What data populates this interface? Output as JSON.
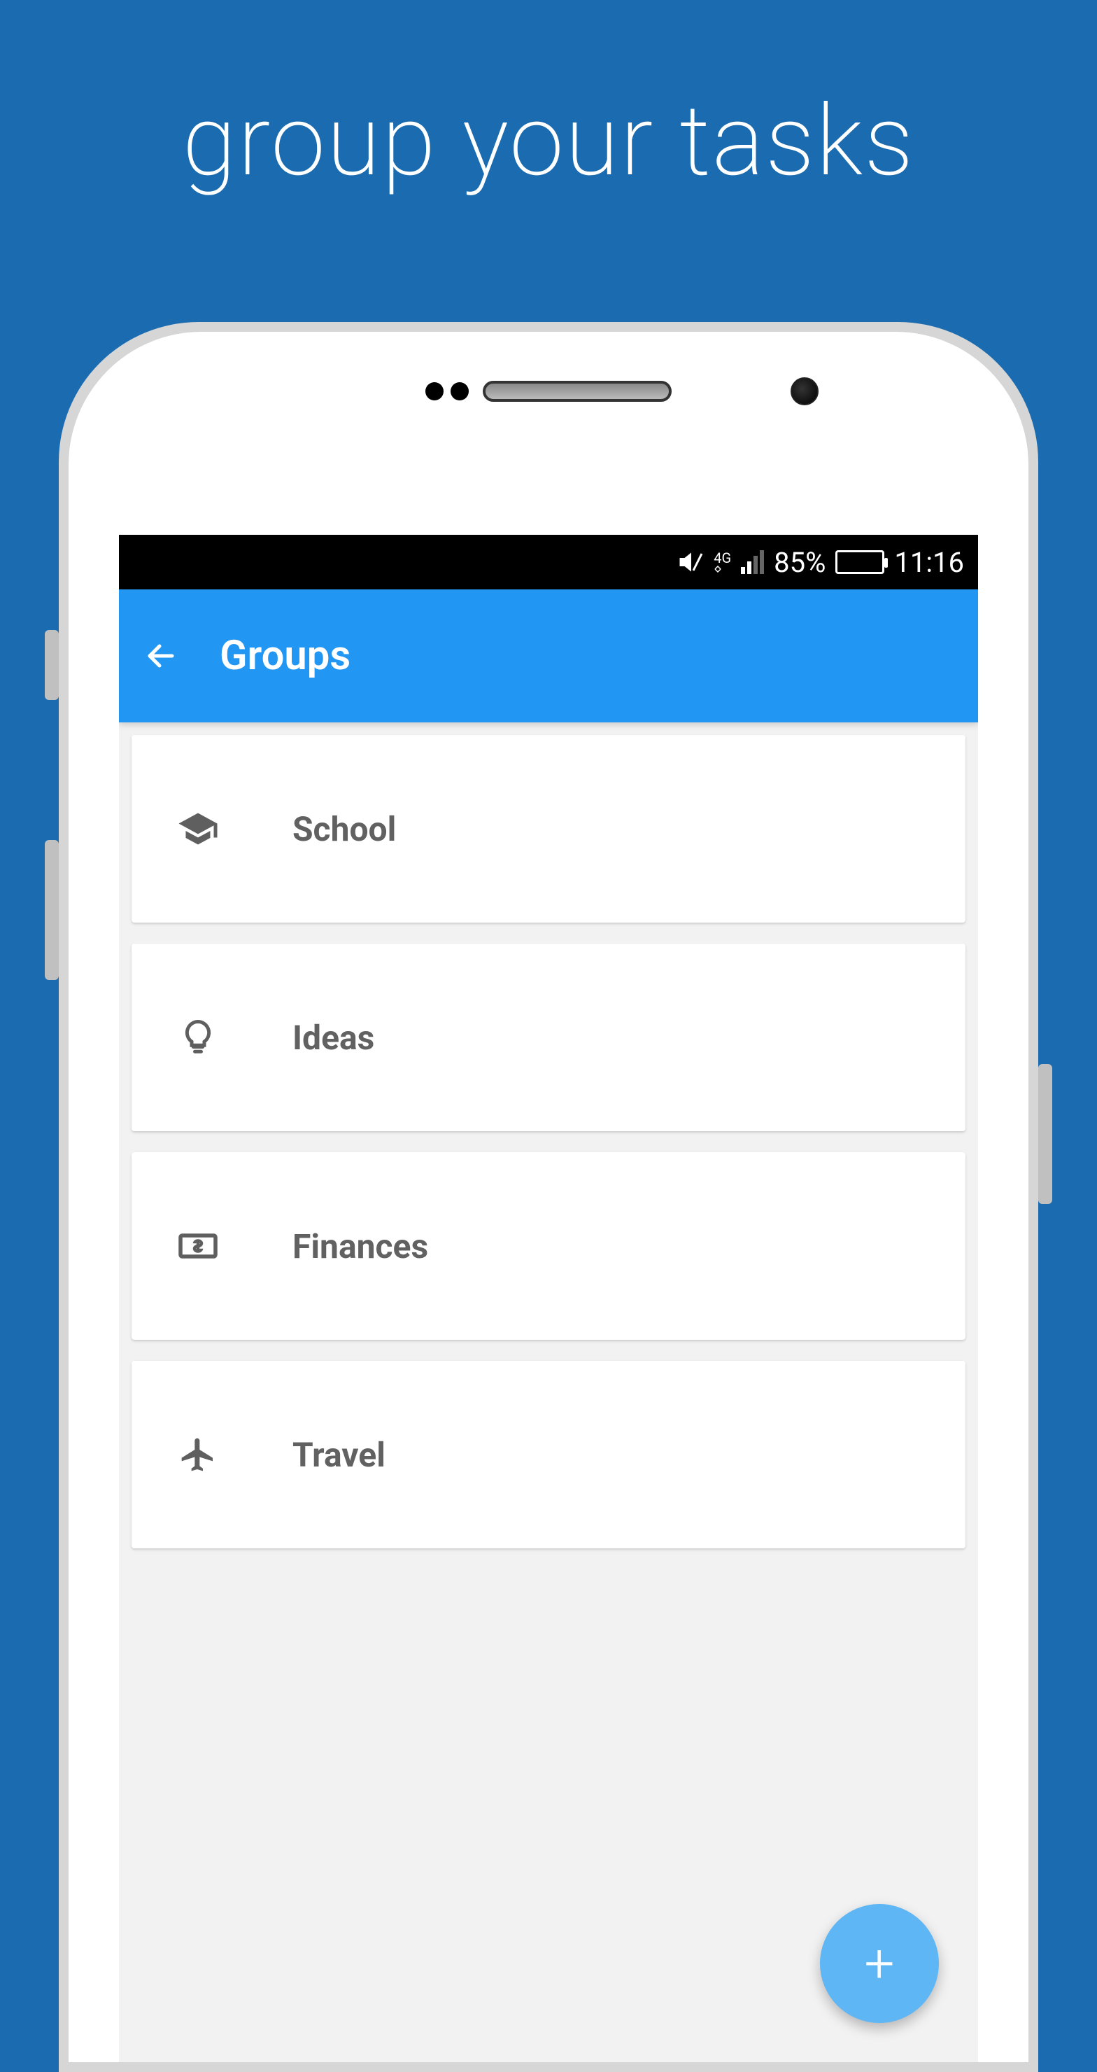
{
  "promo": {
    "title": "group your tasks"
  },
  "statusbar": {
    "battery_pct": "85%",
    "time": "11:16",
    "network": "4G"
  },
  "appbar": {
    "title": "Groups"
  },
  "groups": [
    {
      "icon": "graduation-cap-icon",
      "label": "School"
    },
    {
      "icon": "lightbulb-icon",
      "label": "Ideas"
    },
    {
      "icon": "money-icon",
      "label": "Finances"
    },
    {
      "icon": "airplane-icon",
      "label": "Travel"
    }
  ],
  "fab": {
    "label": "+"
  }
}
